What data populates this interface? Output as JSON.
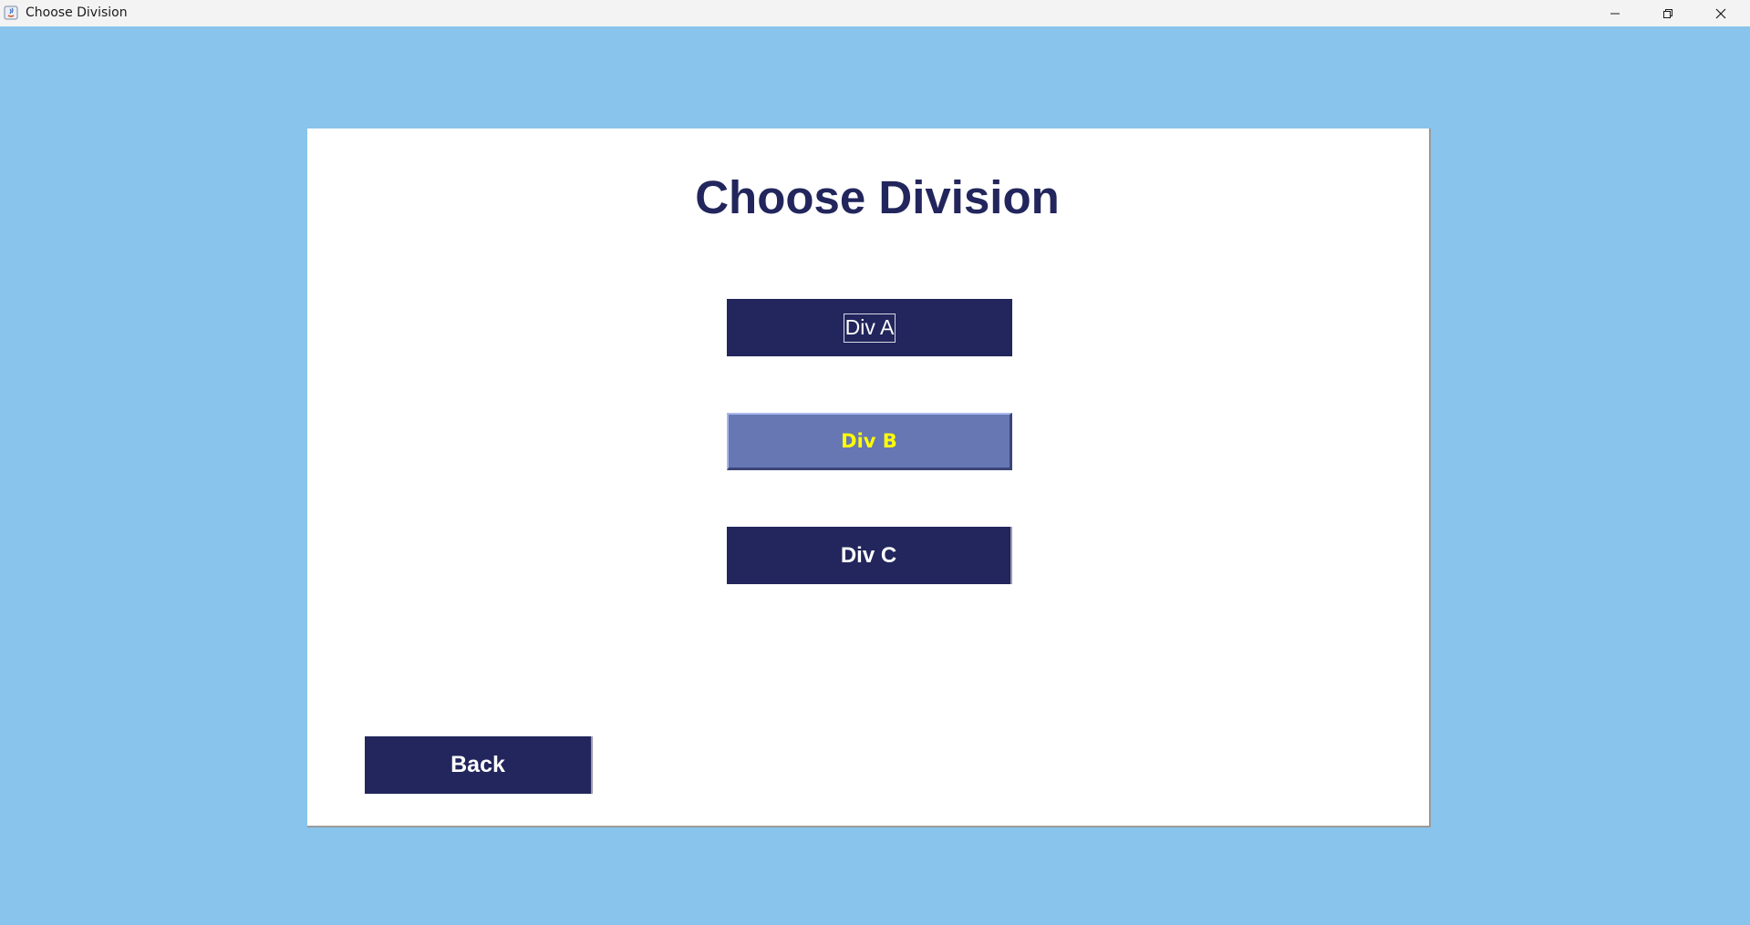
{
  "window": {
    "title": "Choose Division"
  },
  "main": {
    "heading": "Choose Division",
    "buttons": {
      "div_a": "Div A",
      "div_b": "Div B",
      "div_c": "Div C",
      "back": "Back"
    }
  },
  "colors": {
    "background": "#88c4eb",
    "panel": "#ffffff",
    "primary_navy": "#22265c",
    "hover_button": "#6677b3",
    "hover_text": "#ffff00"
  },
  "icons": {
    "app": "java-app-icon",
    "minimize": "minimize-icon",
    "maximize": "restore-icon",
    "close": "close-icon"
  }
}
